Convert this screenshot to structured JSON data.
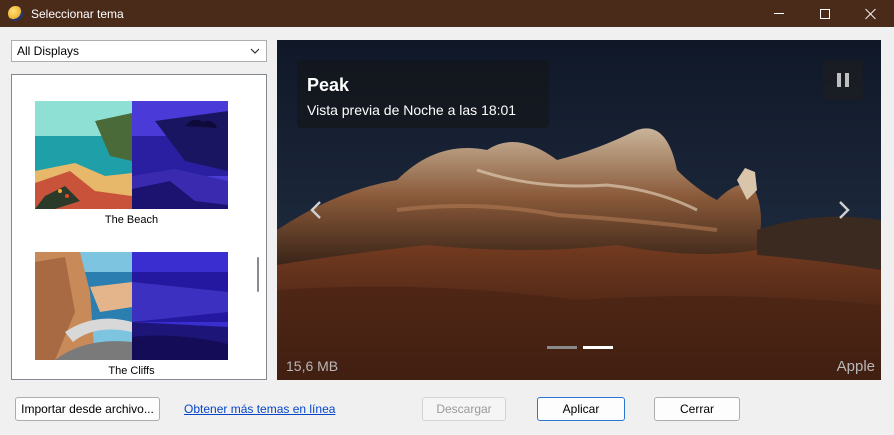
{
  "window": {
    "title": "Seleccionar tema"
  },
  "display_select": {
    "value": "All Displays"
  },
  "themes": [
    {
      "name": "The Beach"
    },
    {
      "name": "The Cliffs"
    }
  ],
  "preview": {
    "title": "Peak",
    "subtitle": "Vista previa de Noche a las 18:01",
    "size": "15,6 MB",
    "author": "Apple",
    "slide_count": 2,
    "active_slide": 2
  },
  "footer": {
    "import_label": "Importar desde archivo...",
    "more_link": "Obtener más temas en línea",
    "download_label": "Descargar",
    "apply_label": "Aplicar",
    "close_label": "Cerrar"
  },
  "colors": {
    "titlebar": "#4a2b1a",
    "accent": "#2a78d4",
    "link": "#0645c8"
  }
}
